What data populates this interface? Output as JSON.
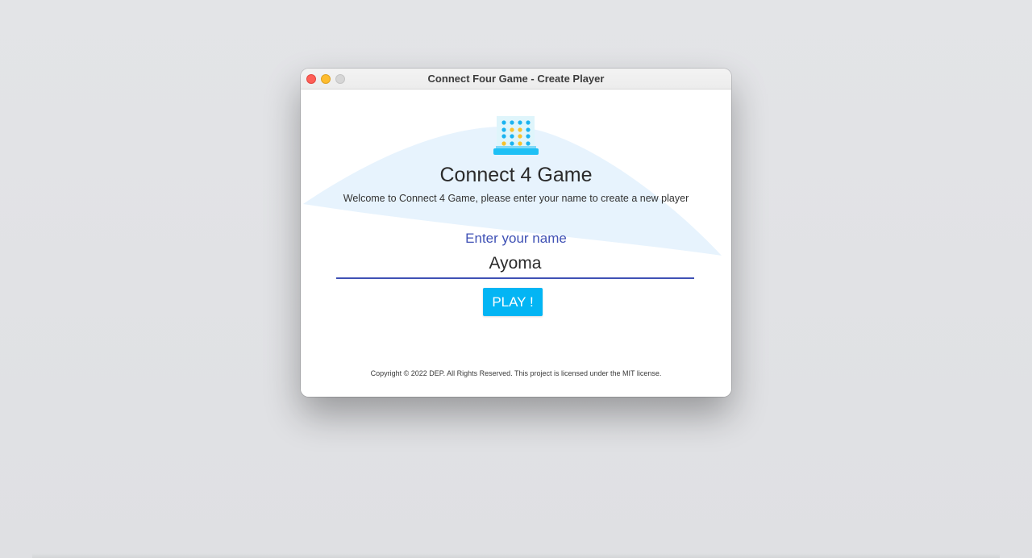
{
  "window": {
    "title": "Connect Four Game - Create Player"
  },
  "logo": {
    "icon": "connect-four-board-icon",
    "colors": {
      "board": "#dff5fb",
      "base": "#1fc0f5",
      "disc_blue": "#1ab3f0",
      "disc_yellow": "#f7c22d"
    }
  },
  "main": {
    "heading": "Connect 4 Game",
    "welcome": "Welcome to Connect 4 Game, please enter your name to create a new player",
    "name_label": "Enter your name",
    "name_value": "Ayoma",
    "play_label": "PLAY !"
  },
  "footer": {
    "copyright": "Copyright © 2022 DEP. All Rights Reserved. This project is licensed under the MIT license."
  },
  "colors": {
    "accent": "#3f51b5",
    "button": "#03b5f4",
    "wave": "#e7f3fd"
  }
}
